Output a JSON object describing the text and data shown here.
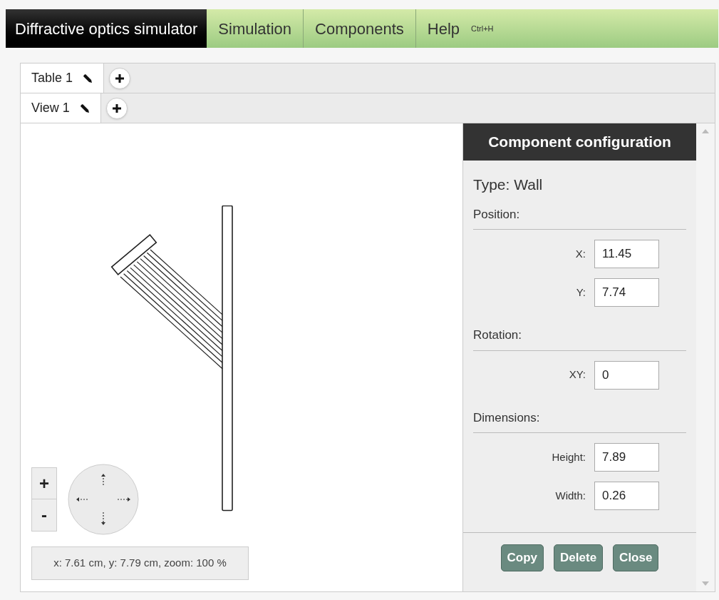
{
  "menu_bar": {
    "title": "Diffractive optics simulator",
    "items": [
      {
        "label": "Simulation"
      },
      {
        "label": "Components"
      },
      {
        "label": "Help",
        "shortcut": "Ctrl+H"
      }
    ]
  },
  "tab_rows": [
    {
      "tabs": [
        {
          "label": "Table 1",
          "selected": true
        }
      ]
    },
    {
      "tabs": [
        {
          "label": "View 1",
          "selected": true
        }
      ]
    }
  ],
  "canvas": {
    "zoom_in": "+",
    "zoom_out": "-",
    "status": "x: 7.61 cm, y: 7.79 cm, zoom: 100 %"
  },
  "panel": {
    "title": "Component configuration",
    "type": "Type: Wall",
    "sections": [
      {
        "heading": "Position:",
        "fields": [
          {
            "label": "X:",
            "value": "11.45"
          },
          {
            "label": "Y:",
            "value": "7.74"
          }
        ]
      },
      {
        "heading": "Rotation:",
        "fields": [
          {
            "label": "XY:",
            "value": "0"
          }
        ]
      },
      {
        "heading": "Dimensions:",
        "fields": [
          {
            "label": "Height:",
            "value": "7.89"
          },
          {
            "label": "Width:",
            "value": "0.26"
          }
        ]
      }
    ],
    "buttons": [
      "Copy",
      "Delete",
      "Close"
    ]
  }
}
